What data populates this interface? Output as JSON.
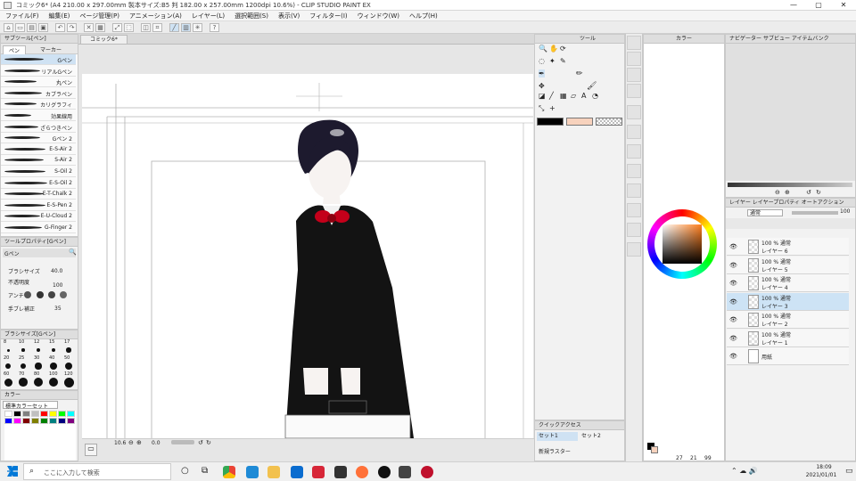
{
  "title_bar": {
    "title": "コミック6* (A4 210.00 x 297.00mm 製本サイズ:B5 判 182.00 x 257.00mm 1200dpi 10.6%) - CLIP STUDIO PAINT EX",
    "minimize": "—",
    "maximize": "▢",
    "close": "✕"
  },
  "menu": [
    "ファイル(F)",
    "編集(E)",
    "ページ管理(P)",
    "アニメーション(A)",
    "レイヤー(L)",
    "選択範囲(S)",
    "表示(V)",
    "フィルター(I)",
    "ウィンドウ(W)",
    "ヘルプ(H)"
  ],
  "canvas_tab": "コミック6*",
  "left_panel": {
    "subtool_header": "サブツール[ペン]",
    "tabs": [
      "ペン",
      "マーカー"
    ],
    "brushes": [
      "Gペン",
      "リアルGペン",
      "丸ペン",
      "カブラペン",
      "カリグラフィ",
      "効果線用",
      "ざらつきペン",
      "Gペン 2",
      "E-S-Air 2",
      "S-Air 2",
      "S-Oil 2",
      "E-S-Oil 2",
      "E-T-Chalk 2",
      "E-S-Pen 2",
      "E-U-Cloud 2",
      "G-Finger 2"
    ],
    "toolprop_header": "ツールプロパティ[Gペン]",
    "toolprop_name": "Gペン",
    "brush_size_label": "ブラシサイズ",
    "brush_size_value": "40.0",
    "opacity_label": "不透明度",
    "opacity_value": "100",
    "antialias_label": "アンチ",
    "stabilize_label": "手ブレ補正",
    "stabilize_value": "35",
    "brushsize_header": "ブラシサイズ[Gペン]",
    "sizes": [
      "8",
      "10",
      "12",
      "15",
      "17",
      "20",
      "25",
      "30",
      "40",
      "50",
      "60",
      "70",
      "80",
      "100",
      "120"
    ],
    "color_set_header": "カラー",
    "color_set_name": "標準カラーセット"
  },
  "status_bar": {
    "zoom": "10.6",
    "rotation": "0.0"
  },
  "tool_panel": {
    "header": "ツール"
  },
  "quick_access": {
    "header": "クイックアクセス",
    "tabs": [
      "セット1",
      "セット2"
    ],
    "item": "新規ラスター"
  },
  "color_panel": {
    "header": "カラー",
    "coords": [
      "27",
      "21",
      "99"
    ]
  },
  "navigator": {
    "tabs": [
      "ナビゲーター",
      "サブビュー",
      "アイテムバンク"
    ]
  },
  "layer_panel": {
    "tabs": [
      "レイヤー",
      "レイヤープロパティ",
      "オートアクション"
    ],
    "blend_mode": "通常",
    "opacity": "100",
    "layers": [
      {
        "mode": "100 % 通常",
        "name": "レイヤー 6"
      },
      {
        "mode": "100 % 通常",
        "name": "レイヤー 5"
      },
      {
        "mode": "100 % 通常",
        "name": "レイヤー 4"
      },
      {
        "mode": "100 % 通常",
        "name": "レイヤー 3"
      },
      {
        "mode": "100 % 通常",
        "name": "レイヤー 2"
      },
      {
        "mode": "100 % 通常",
        "name": "レイヤー 1"
      },
      {
        "mode": "",
        "name": "用紙"
      }
    ]
  },
  "taskbar": {
    "search_placeholder": "ここに入力して検索",
    "time": "18:09",
    "date": "2021/01/01"
  },
  "colors": {
    "accent": "#cfe2f3",
    "main_color": "#000000",
    "sub_color": "#f7d2bd"
  }
}
